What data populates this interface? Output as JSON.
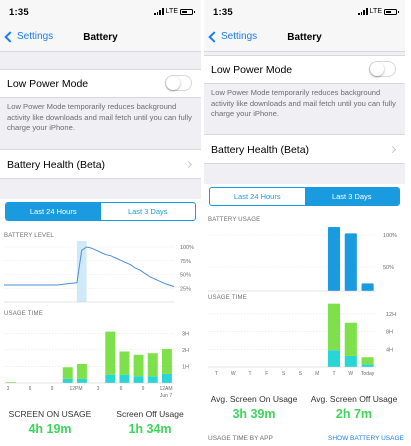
{
  "colors": {
    "blue_accent": "#1a7cf7",
    "segment_blue": "#1a9be0",
    "usage_green": "#7ee04a",
    "usage_cyan": "#29d6d6",
    "level_line": "#4a8ed6",
    "highlight": "#cfe9f7"
  },
  "left": {
    "status": {
      "time": "1:35",
      "carrier": "LTE"
    },
    "nav": {
      "back_label": "Settings",
      "title": "Battery"
    },
    "low_power": {
      "label": "Low Power Mode",
      "on": false,
      "footnote": "Low Power Mode temporarily reduces background activity like downloads and mail fetch until you can fully charge your iPhone."
    },
    "battery_health": {
      "label": "Battery Health (Beta)"
    },
    "segments": {
      "first": "Last 24 Hours",
      "second": "Last 3 Days",
      "active": "first"
    },
    "battery_level": {
      "label": "BATTERY LEVEL",
      "ticks": [
        "100%",
        "75%",
        "50%",
        "25%"
      ]
    },
    "usage_time": {
      "label": "USAGE TIME",
      "y_ticks": [
        "3H",
        "2H",
        "1H"
      ],
      "x_ticks": [
        "3",
        "6",
        "9",
        "12PM",
        "3",
        "6",
        "9",
        "12AM"
      ],
      "date": "Jun 7"
    },
    "summary": {
      "on_label": "SCREEN ON USAGE",
      "on_value": "4h 19m",
      "off_label": "Screen Off Usage",
      "off_value": "1h 34m"
    }
  },
  "right": {
    "status": {
      "time": "1:35",
      "carrier": "LTE"
    },
    "nav": {
      "back_label": "Settings",
      "title": "Battery"
    },
    "low_power": {
      "label": "Low Power Mode",
      "on": false,
      "footnote": "Low Power Mode temporarily reduces background activity like downloads and mail fetch until you can fully charge your iPhone."
    },
    "battery_health": {
      "label": "Battery Health (Beta)"
    },
    "segments": {
      "first": "Last 24 Hours",
      "second": "Last 3 Days",
      "active": "second"
    },
    "battery_usage": {
      "label": "BATTERY USAGE",
      "ticks": [
        "100%",
        "50%"
      ]
    },
    "usage_time": {
      "label": "USAGE TIME",
      "y_ticks": [
        "12H",
        "8H",
        "4H"
      ],
      "x_ticks": [
        "T",
        "W",
        "T",
        "F",
        "S",
        "S",
        "M",
        "T",
        "W",
        "Today"
      ]
    },
    "summary": {
      "on_label": "Avg. Screen On Usage",
      "on_value": "3h 39m",
      "off_label": "Avg. Screen Off Usage",
      "off_value": "2h 7m"
    },
    "footer": {
      "left": "USAGE TIME BY APP",
      "right": "SHOW BATTERY USAGE"
    }
  },
  "chart_data": [
    {
      "type": "line",
      "title": "BATTERY LEVEL",
      "x": [
        "3",
        "6",
        "9",
        "12PM",
        "3",
        "6",
        "9",
        "12AM"
      ],
      "values_percent": [
        31,
        31,
        31,
        31,
        31,
        31,
        31,
        31,
        31,
        31,
        31,
        31,
        32,
        33,
        34,
        35,
        94,
        100,
        98,
        94,
        90,
        86,
        84,
        80,
        76,
        72,
        68,
        62,
        58,
        52,
        46,
        42,
        38,
        34,
        31,
        28
      ],
      "ylim": [
        0,
        100
      ]
    },
    {
      "type": "bar",
      "title": "USAGE TIME",
      "categories": [
        "3",
        "6",
        "9",
        "12PM",
        "3",
        "6",
        "9",
        "12AM"
      ],
      "ylim": [
        0,
        3.5
      ],
      "series": [
        {
          "name": "Screen On",
          "values": [
            0.05,
            0,
            0,
            0,
            0.7,
            0.9,
            0,
            2.6,
            1.4,
            1.3,
            1.4,
            1.5
          ]
        },
        {
          "name": "Screen Off",
          "values": [
            0,
            0,
            0,
            0,
            0.25,
            0.25,
            0,
            0.5,
            0.5,
            0.4,
            0.4,
            0.55
          ]
        }
      ]
    },
    {
      "type": "bar",
      "title": "BATTERY USAGE",
      "categories": [
        "T",
        "W",
        "T",
        "F",
        "S",
        "S",
        "M",
        "T",
        "W",
        "Today"
      ],
      "ylim": [
        0,
        100
      ],
      "series": [
        {
          "name": "Battery",
          "values": [
            0,
            0,
            0,
            0,
            0,
            0,
            0,
            100,
            90,
            12
          ]
        }
      ]
    },
    {
      "type": "bar",
      "title": "USAGE TIME",
      "categories": [
        "T",
        "W",
        "T",
        "F",
        "S",
        "S",
        "M",
        "T",
        "W",
        "Today"
      ],
      "ylim": [
        0,
        14
      ],
      "series": [
        {
          "name": "Screen On",
          "values": [
            0,
            0,
            0,
            0,
            0,
            0,
            0,
            10.5,
            7.5,
            1.6
          ]
        },
        {
          "name": "Screen Off",
          "values": [
            0,
            0,
            0,
            0,
            0,
            0,
            0,
            3.8,
            2.5,
            0.6
          ]
        }
      ]
    }
  ]
}
